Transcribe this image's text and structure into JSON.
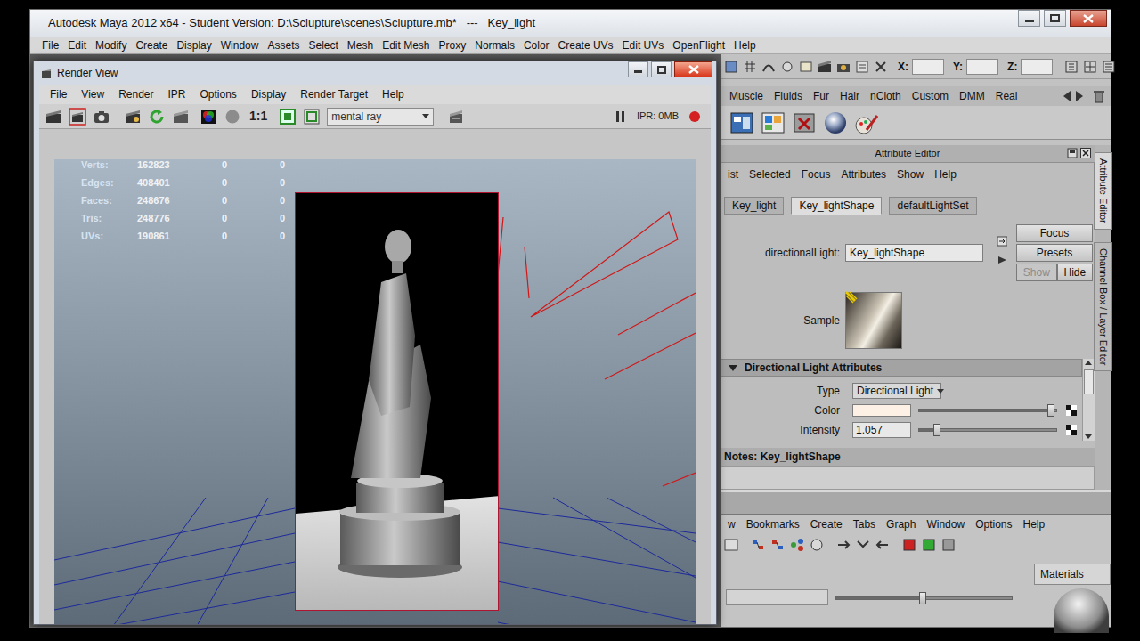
{
  "window": {
    "title": "Autodesk Maya 2012 x64 - Student Version: D:\\Sclupture\\scenes\\Sclupture.mb*   ---   Key_light"
  },
  "main_menu": [
    "File",
    "Edit",
    "Modify",
    "Create",
    "Display",
    "Window",
    "Assets",
    "Select",
    "Mesh",
    "Edit Mesh",
    "Proxy",
    "Normals",
    "Color",
    "Create UVs",
    "Edit UVs",
    "OpenFlight",
    "Help"
  ],
  "render_view": {
    "title": "Render View",
    "menu": [
      "File",
      "View",
      "Render",
      "IPR",
      "Options",
      "Display",
      "Render Target",
      "Help"
    ],
    "zoom": "1:1",
    "renderer": "mental ray",
    "ipr": "IPR: 0MB",
    "close_hovered": true,
    "stats": [
      {
        "label": "Verts:",
        "values": [
          "162823",
          "0",
          "0"
        ]
      },
      {
        "label": "Edges:",
        "values": [
          "408401",
          "0",
          "0"
        ]
      },
      {
        "label": "Faces:",
        "values": [
          "248676",
          "0",
          "0"
        ]
      },
      {
        "label": "Tris:",
        "values": [
          "248776",
          "0",
          "0"
        ]
      },
      {
        "label": "UVs:",
        "values": [
          "190861",
          "0",
          "0"
        ]
      }
    ]
  },
  "status_line": {
    "labels": [
      "X:",
      "Y:",
      "Z:"
    ]
  },
  "shelf_tabs": [
    {
      "label": "Muscle",
      "selected": false
    },
    {
      "label": "Fluids",
      "selected": false
    },
    {
      "label": "Fur",
      "selected": false
    },
    {
      "label": "Hair",
      "selected": false
    },
    {
      "label": "nCloth",
      "selected": false
    },
    {
      "label": "Custom",
      "selected": false
    },
    {
      "label": "DMM",
      "selected": false
    },
    {
      "label": "Real",
      "selected": false
    }
  ],
  "attribute_editor": {
    "title": "Attribute Editor",
    "menu": [
      "ist",
      "Selected",
      "Focus",
      "Attributes",
      "Show",
      "Help"
    ],
    "tabs": [
      {
        "label": "Key_light",
        "selected": false
      },
      {
        "label": "Key_lightShape",
        "selected": true
      },
      {
        "label": "defaultLightSet",
        "selected": false
      }
    ],
    "node_label": "directionalLight:",
    "node_name": "Key_lightShape",
    "buttons": [
      {
        "label": "Focus",
        "disabled": false
      },
      {
        "label": "Presets",
        "disabled": false
      },
      {
        "label": "Show",
        "disabled": true
      },
      {
        "label": "Hide",
        "disabled": false
      }
    ],
    "sample_label": "Sample",
    "section": {
      "title": "Directional Light Attributes",
      "expanded": true
    },
    "type": {
      "label": "Type",
      "value": "Directional Light"
    },
    "color": {
      "label": "Color",
      "swatch": "#fdf0e4",
      "level": 0.96
    },
    "intensity": {
      "label": "Intensity",
      "value": "1.057",
      "level": 0.13
    },
    "notes": "Notes: Key_lightShape"
  },
  "side_tabs": [
    {
      "label": "Attribute Editor",
      "selected": true
    },
    {
      "label": "Channel Box / Layer Editor",
      "selected": false
    }
  ],
  "hypershade": {
    "menu": [
      "w",
      "Bookmarks",
      "Create",
      "Tabs",
      "Graph",
      "Window",
      "Options",
      "Help"
    ],
    "slider": {
      "level": 0.49
    },
    "tab": "Materials"
  }
}
